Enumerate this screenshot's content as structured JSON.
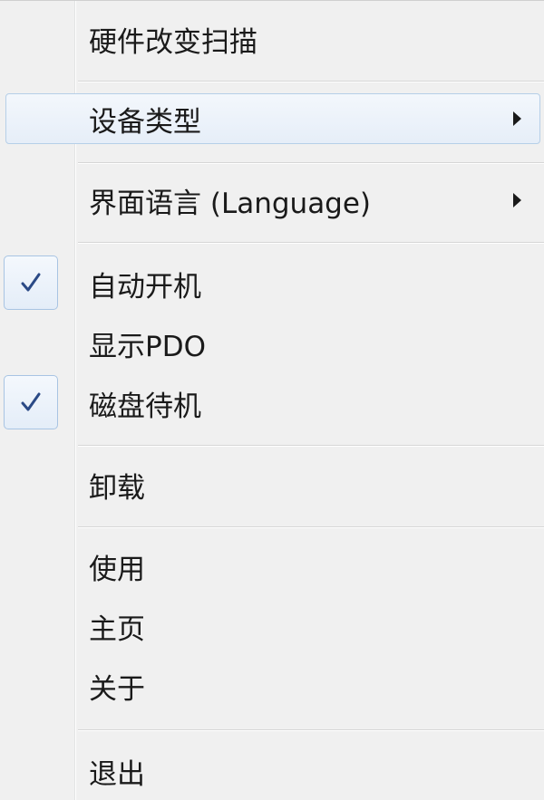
{
  "menu": {
    "items": [
      {
        "label": "硬件改变扫描"
      },
      {
        "label": "设备类型"
      },
      {
        "label": "界面语言 (Language)"
      },
      {
        "label": "自动开机"
      },
      {
        "label": "显示PDO"
      },
      {
        "label": "磁盘待机"
      },
      {
        "label": "卸载"
      },
      {
        "label": "使用"
      },
      {
        "label": "主页"
      },
      {
        "label": "关于"
      },
      {
        "label": "退出"
      }
    ]
  },
  "state": {
    "highlighted_item": "设备类型",
    "checked_items": [
      "自动开机",
      "磁盘待机"
    ],
    "submenu_items": [
      "设备类型",
      "界面语言 (Language)"
    ]
  },
  "icons": {
    "check": "check-icon",
    "submenu": "submenu-arrow-icon"
  },
  "colors": {
    "menu_background": "#f0f0f0",
    "highlight_border": "#b6cfe8",
    "check_color": "#2b4a86",
    "text": "#1a1a1a"
  }
}
